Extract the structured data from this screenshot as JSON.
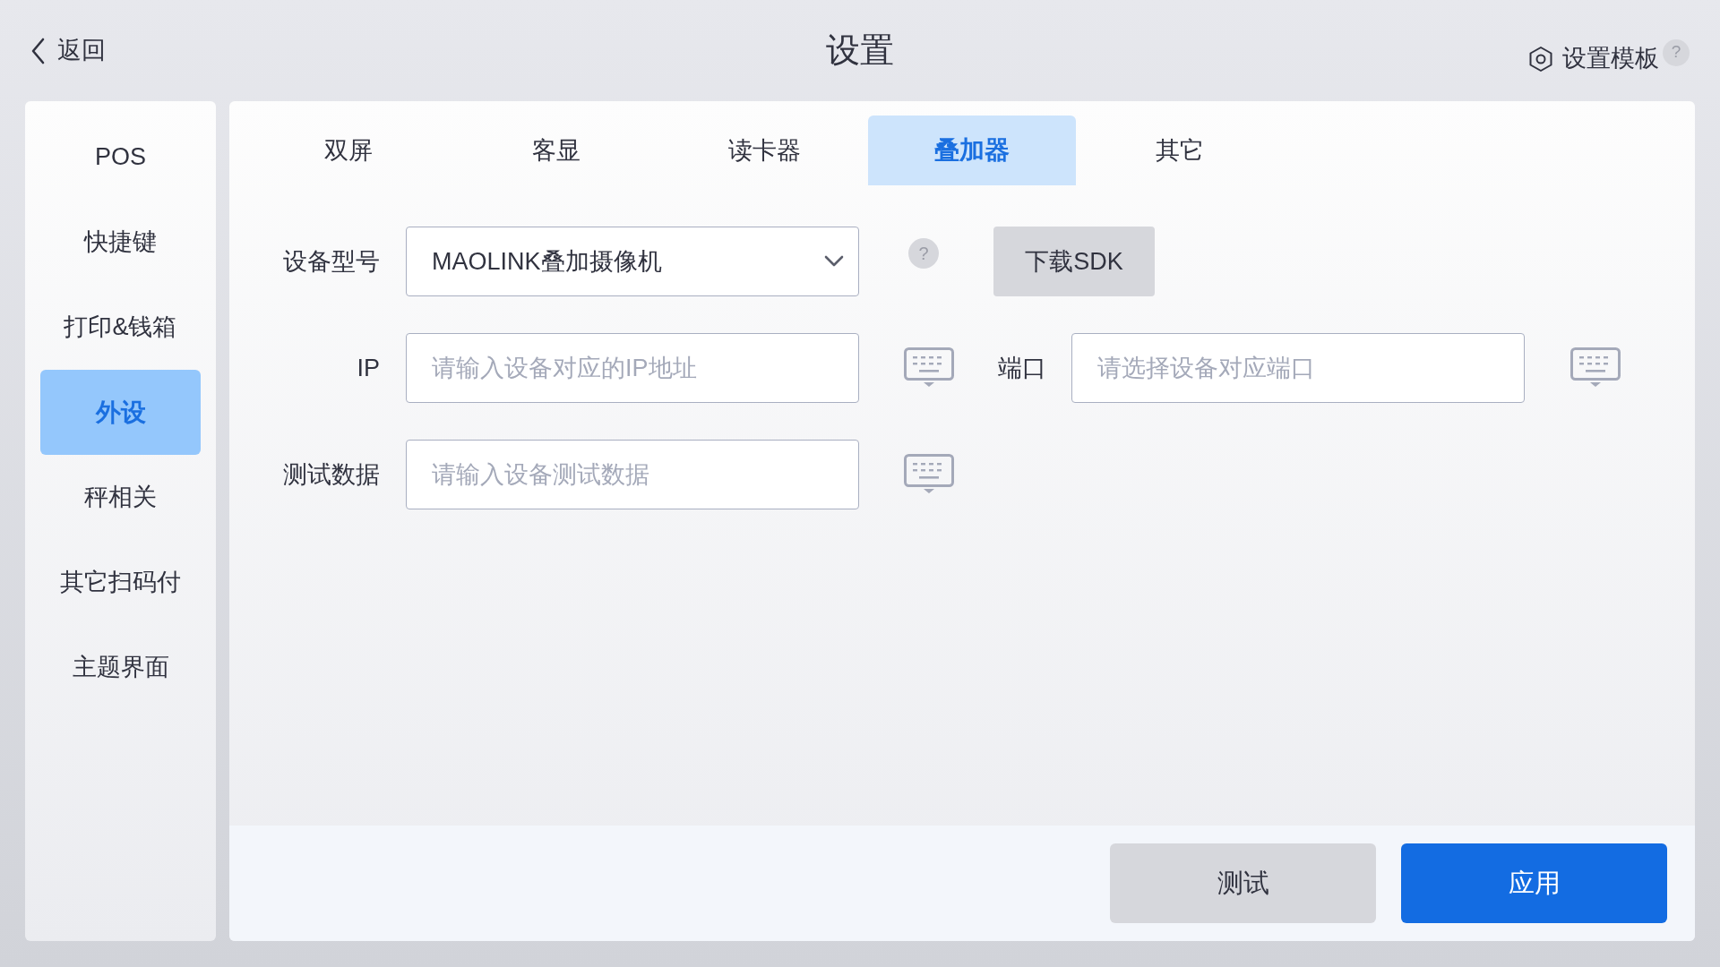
{
  "header": {
    "back_label": "返回",
    "title": "设置",
    "template_label": "设置模板",
    "template_help": "?"
  },
  "sidebar": {
    "items": [
      {
        "label": "POS",
        "selected": false
      },
      {
        "label": "快捷键",
        "selected": false
      },
      {
        "label": "打印&钱箱",
        "selected": false
      },
      {
        "label": "外设",
        "selected": true
      },
      {
        "label": "秤相关",
        "selected": false
      },
      {
        "label": "其它扫码付",
        "selected": false
      },
      {
        "label": "主题界面",
        "selected": false
      }
    ]
  },
  "tabs": [
    {
      "label": "双屏",
      "selected": false
    },
    {
      "label": "客显",
      "selected": false
    },
    {
      "label": "读卡器",
      "selected": false
    },
    {
      "label": "叠加器",
      "selected": true
    },
    {
      "label": "其它",
      "selected": false
    }
  ],
  "form": {
    "device_model": {
      "label": "设备型号",
      "value": "MAOLINK叠加摄像机",
      "help": "?"
    },
    "download_button": "下载SDK",
    "ip": {
      "label": "IP",
      "placeholder": "请输入设备对应的IP地址"
    },
    "port": {
      "label": "端口",
      "placeholder": "请选择设备对应端口"
    },
    "test_data": {
      "label": "测试数据",
      "placeholder": "请输入设备测试数据"
    }
  },
  "footer": {
    "buttons": [
      {
        "label": "测试",
        "kind": "secondary"
      },
      {
        "label": "应用",
        "kind": "primary"
      }
    ]
  }
}
